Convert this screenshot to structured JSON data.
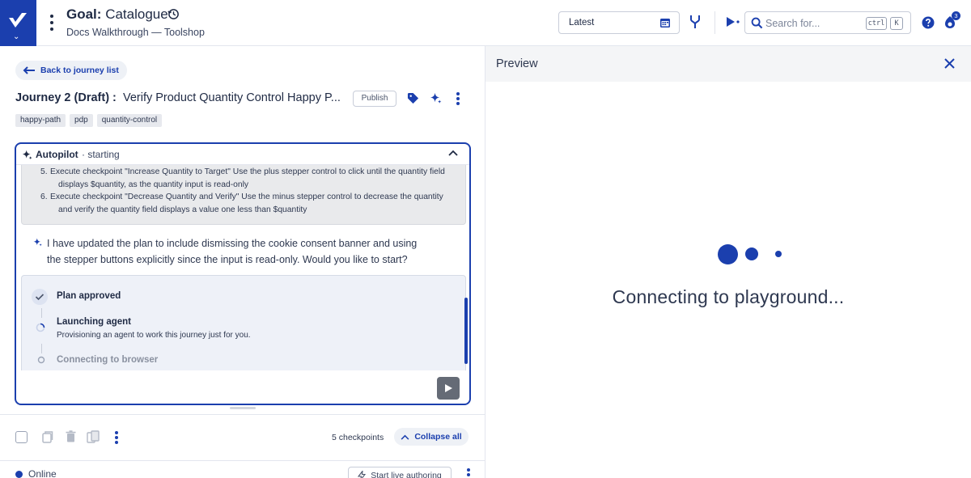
{
  "header": {
    "goal_prefix": "Goal:",
    "goal_name": "Catalogue",
    "subtitle": "Docs Walkthrough — Toolshop",
    "version_select": "Latest",
    "search_placeholder": "Search for...",
    "shortcut_ctrl": "ctrl",
    "shortcut_key": "K",
    "notification_count": "3",
    "accent_color": "#1b3fae"
  },
  "journey": {
    "back_label": "Back to journey list",
    "title_prefix": "Journey 2 (Draft) :",
    "title": "Verify Product Quantity Control Happy P...",
    "publish_label": "Publish",
    "tags": [
      "happy-path",
      "pdp",
      "quantity-control"
    ]
  },
  "autopilot": {
    "title": "Autopilot",
    "status": "· starting",
    "plan_steps": [
      {
        "num": "5.",
        "line1": "Execute checkpoint \"Increase Quantity to Target\" Use the plus stepper control to click until the quantity field",
        "line2": "displays $quantity, as the quantity input is read-only"
      },
      {
        "num": "6.",
        "line1": "Execute checkpoint \"Decrease Quantity and Verify\" Use the minus stepper control to decrease the quantity",
        "line2": "and verify the quantity field displays a value one less than $quantity"
      }
    ],
    "message_line1": "I have updated the plan to include dismissing the cookie consent banner and using",
    "message_line2": "the stepper buttons explicitly since the input is read-only. Would you like to start?",
    "progress": {
      "step1_label": "Plan approved",
      "step2_label": "Launching agent",
      "step2_desc": "Provisioning an agent to work this journey just for you.",
      "step3_label": "Connecting to browser"
    }
  },
  "toolbar": {
    "checkpoints_count": "5 checkpoints",
    "collapse_all_label": "Collapse all"
  },
  "status": {
    "online_label": "Online",
    "live_authoring_label": "Start live authoring"
  },
  "preview": {
    "title": "Preview",
    "connecting_text": "Connecting to playground..."
  }
}
